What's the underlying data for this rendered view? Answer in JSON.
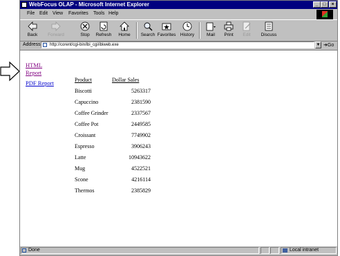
{
  "window": {
    "title": "WebFocus OLAP - Microsoft Internet Explorer"
  },
  "menu": [
    "File",
    "Edit",
    "View",
    "Favorites",
    "Tools",
    "Help"
  ],
  "toolbar": {
    "back": "Back",
    "forward": "Forward",
    "stop": "Stop",
    "refresh": "Refresh",
    "home": "Home",
    "search": "Search",
    "favorites": "Favorites",
    "history": "History",
    "mail": "Mail",
    "print": "Print",
    "edit": "Edit",
    "discuss": "Discuss"
  },
  "address": {
    "label": "Address",
    "url": "http://corent/cgi-bin/ibi_cgi/ibiweb.exe",
    "go": "Go"
  },
  "links": {
    "html": "HTML",
    "report": "Report",
    "pdf": "PDF Report"
  },
  "table": {
    "headers": [
      "Product",
      "Dollar Sales"
    ],
    "rows": [
      [
        "Biscotti",
        "5263317"
      ],
      [
        "Capuccino",
        "2381590"
      ],
      [
        "Coffee Grinder",
        "2337567"
      ],
      [
        "Coffee Pot",
        "2449585"
      ],
      [
        "Croissant",
        "7749902"
      ],
      [
        "Espresso",
        "3906243"
      ],
      [
        "Latte",
        "10943622"
      ],
      [
        "Mug",
        "4522521"
      ],
      [
        "Scone",
        "4216114"
      ],
      [
        "Thermos",
        "2385829"
      ]
    ]
  },
  "status": {
    "text": "Done",
    "zone": "Local intranet"
  },
  "colors": {
    "titlebar": "#000080",
    "link": "#0000cc",
    "visited_link": "#800080"
  }
}
